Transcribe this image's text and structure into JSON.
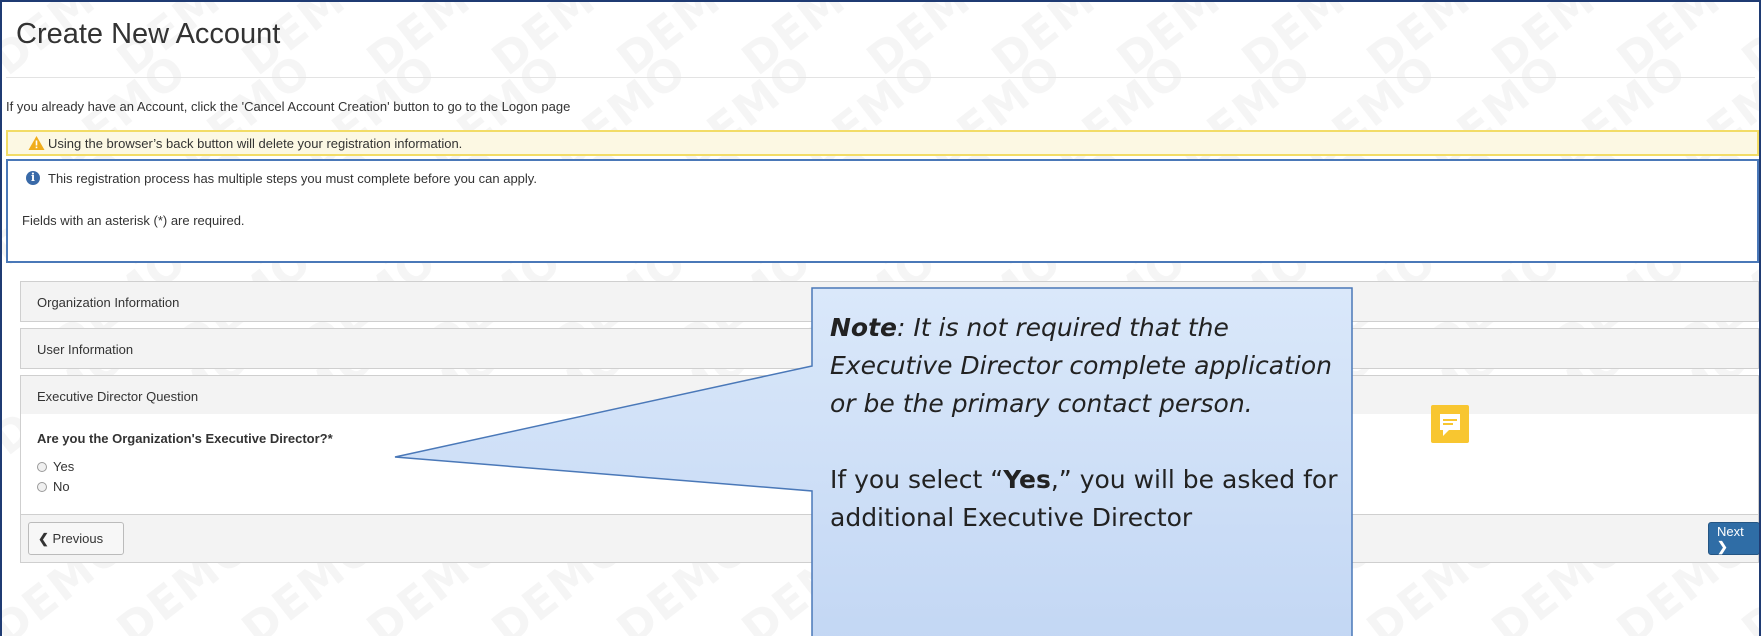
{
  "page": {
    "title": "Create New Account",
    "intro": "If you already have an Account, click the 'Cancel Account Creation' button to go to the Logon page"
  },
  "alerts": {
    "warning": "Using the browser’s back button will delete your registration information.",
    "info_line1": "This registration process has multiple steps you must complete before you can apply.",
    "info_line2": "Fields with an asterisk (*) are required."
  },
  "sections": [
    {
      "label": "Organization Information"
    },
    {
      "label": "User Information"
    },
    {
      "label": "Executive Director Question"
    }
  ],
  "question": {
    "label": "Are you the Organization's Executive Director?*",
    "options": [
      "Yes",
      "No"
    ]
  },
  "buttons": {
    "previous": "Previous",
    "next": "Next"
  },
  "callout": {
    "note_bold": "Note",
    "note_rest": ": It is not required that the Executive Director complete application or be the primary contact person.",
    "yes_prefix": "If you select “",
    "yes_bold": "Yes",
    "yes_suffix": ",” you will be asked for additional Executive Director"
  },
  "icons": {
    "warning": "warning-triangle-icon",
    "info": "info-circle-icon",
    "comment": "comment-note-icon"
  },
  "colors": {
    "warning_border": "#f2dc66",
    "info_border": "#4a78b8",
    "next_button": "#2f6da6",
    "callout_fill": "#cfe0f7",
    "comment_icon": "#f8c630"
  },
  "watermark": "DEMO"
}
